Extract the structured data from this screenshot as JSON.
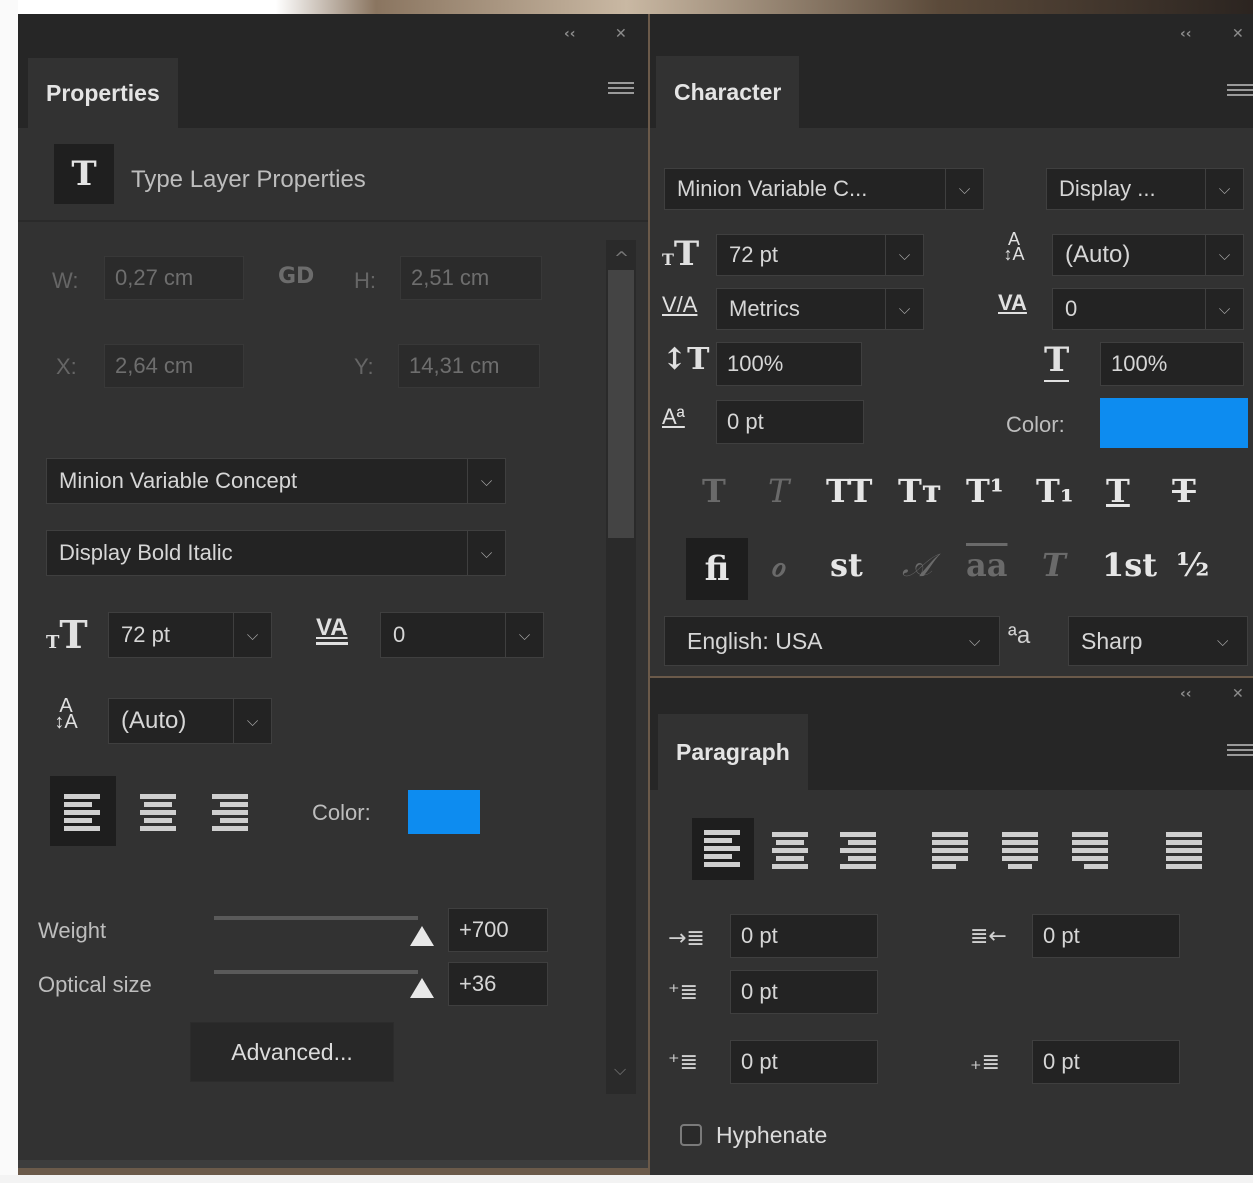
{
  "properties": {
    "tab_label": "Properties",
    "header_icon": "T",
    "header_title": "Type Layer Properties",
    "w_label": "W:",
    "w_value": "0,27 cm",
    "h_label": "H:",
    "h_value": "2,51 cm",
    "x_label": "X:",
    "x_value": "2,64 cm",
    "y_label": "Y:",
    "y_value": "14,31 cm",
    "link_icon": "chain-link-icon",
    "font_family": "Minion Variable Concept",
    "font_style": "Display Bold Italic",
    "font_size": "72 pt",
    "tracking": "0",
    "leading": "(Auto)",
    "color_label": "Color:",
    "color_value": "#0d8cf0",
    "weight_label": "Weight",
    "weight_value": "+700",
    "optical_label": "Optical size",
    "optical_value": "+36",
    "advanced_label": "Advanced..."
  },
  "character": {
    "tab_label": "Character",
    "font_family": "Minion Variable C...",
    "font_style": "Display ...",
    "font_size": "72 pt",
    "leading": "(Auto)",
    "kerning": "Metrics",
    "tracking": "0",
    "vertical_scale": "100%",
    "horizontal_scale": "100%",
    "baseline_shift": "0 pt",
    "color_label": "Color:",
    "color_value": "#0d8cf0",
    "language": "English: USA",
    "antialias_icon_text": "ªa",
    "antialias": "Sharp"
  },
  "paragraph": {
    "tab_label": "Paragraph",
    "indent_left": "0 pt",
    "indent_right": "0 pt",
    "indent_first": "0 pt",
    "space_before": "0 pt",
    "space_after": "0 pt",
    "hyphenate_label": "Hyphenate",
    "hyphenate_checked": false
  },
  "glyphs": {
    "size_icon": "T",
    "size_icon_small": "T",
    "kerning_icon": "V/A",
    "tracking_icon": "VA",
    "leading_icon_top": "A",
    "leading_icon_bottom": "A",
    "vscale_icon": "↕T",
    "hscale_icon": "T",
    "baseline_icon": "Aª",
    "style_faux_bold": "T",
    "style_faux_italic": "T",
    "style_all_caps": "TT",
    "style_small_caps": "Tт",
    "style_superscript": "T¹",
    "style_subscript": "T₁",
    "style_underline": "T",
    "style_strikethrough": "T",
    "ot_ligatures": "ﬁ",
    "ot_old_style": "ℴ",
    "ot_discretionary": "st",
    "ot_swash": "𝒜",
    "ot_titling": "aa",
    "ot_ordinals": "T",
    "ot_ordinal_sup": "1st",
    "ot_fractions": "½",
    "collapse": "‹‹",
    "close": "✕",
    "chevron": "⌵",
    "scroll_up": "^",
    "scroll_down": "⌵"
  }
}
